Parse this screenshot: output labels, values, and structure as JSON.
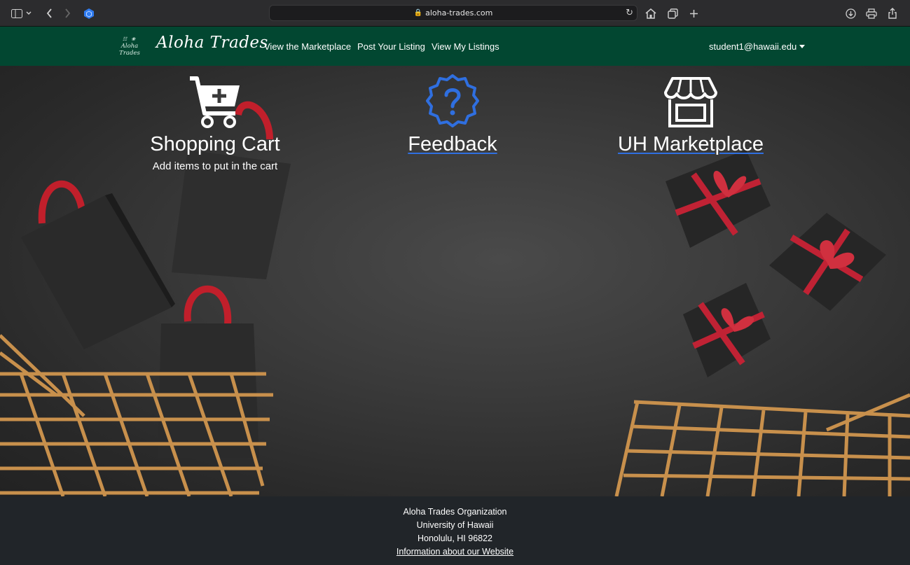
{
  "browser": {
    "url": "aloha-trades.com",
    "accent_color": "#2f7bf0"
  },
  "navbar": {
    "logo_small_text": "Aloha Trades",
    "brand": "Aloha Trades",
    "links": [
      "View the Marketplace",
      "Post Your Listing",
      "View My Listings"
    ],
    "user": "student1@hawaii.edu",
    "background_color": "#024731"
  },
  "features": [
    {
      "title": "Shopping Cart",
      "subtitle": "Add items to put in the cart",
      "icon": "cart-plus-icon"
    },
    {
      "title": "Feedback",
      "icon": "question-badge-icon"
    },
    {
      "title": "UH Marketplace",
      "icon": "storefront-icon"
    }
  ],
  "footer": {
    "lines": [
      "Aloha Trades Organization",
      "University of Hawaii",
      "Honolulu, HI 96822"
    ],
    "link": "Information about our Website"
  }
}
